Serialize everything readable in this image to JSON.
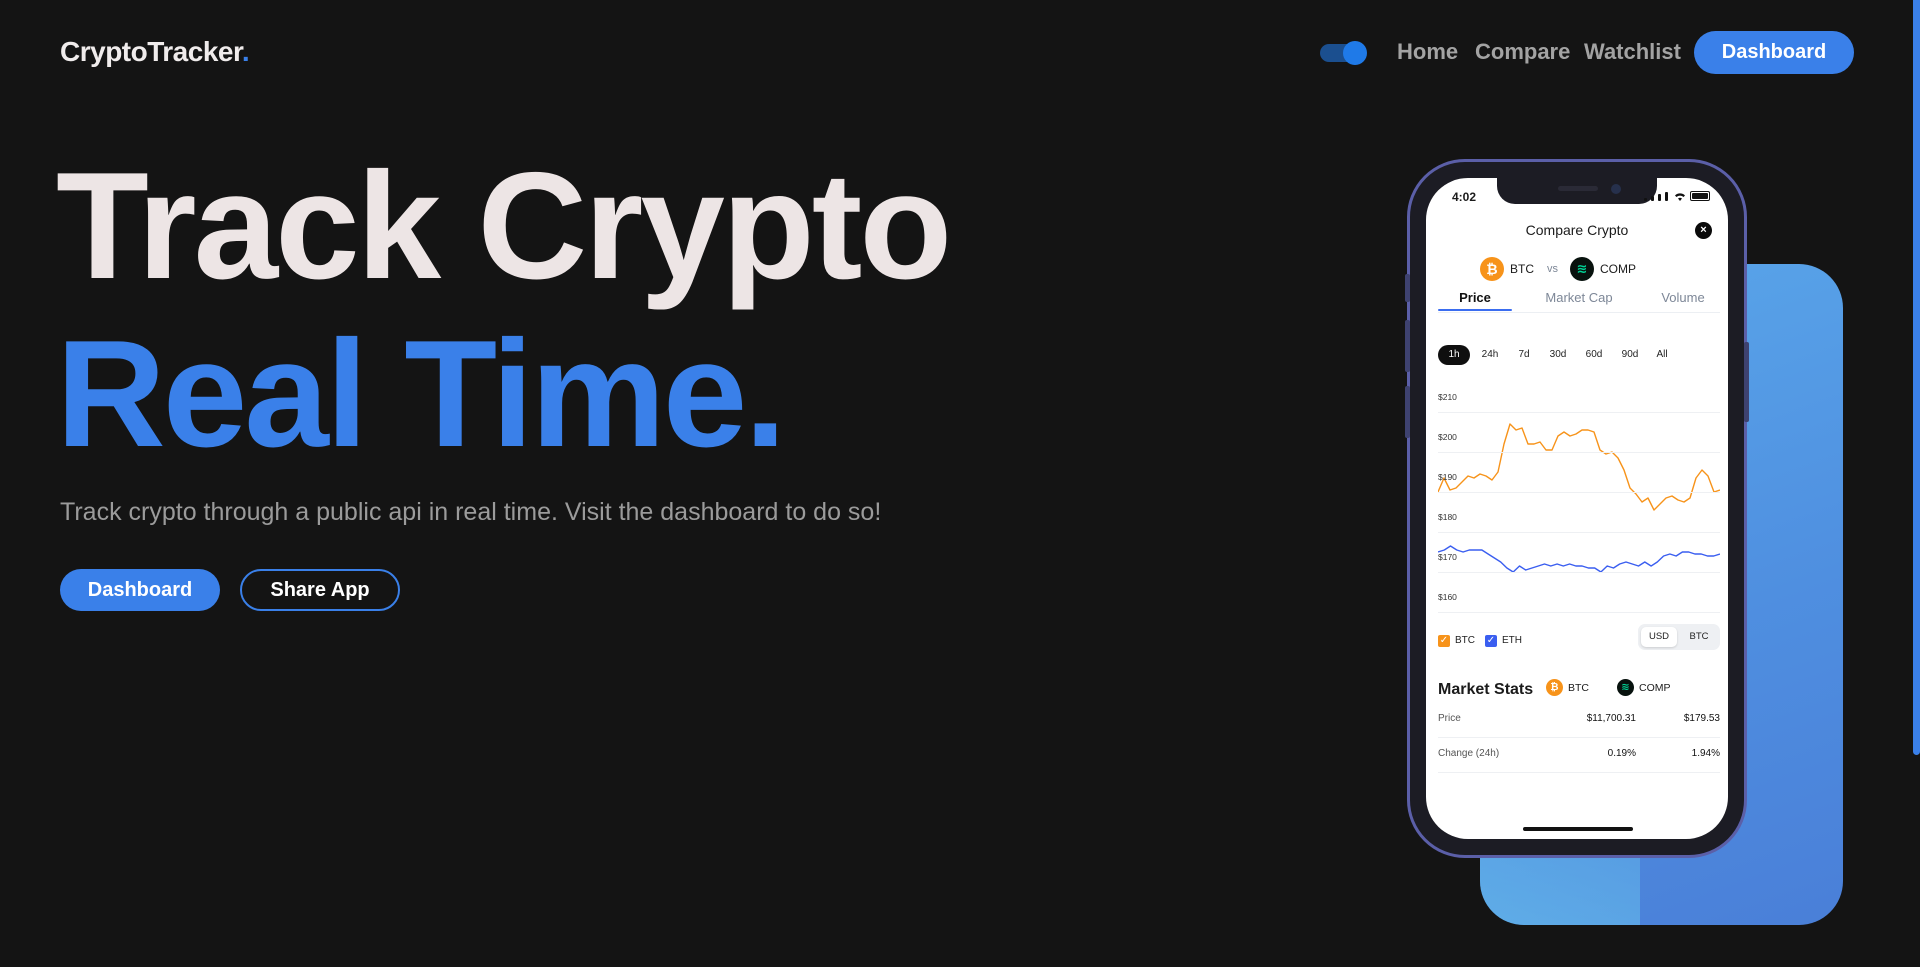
{
  "nav": {
    "logo": "CryptoTracker",
    "logo_dot": ".",
    "links": [
      "Home",
      "Compare",
      "Watchlist"
    ],
    "dashboard_label": "Dashboard"
  },
  "hero": {
    "title_line1": "Track Crypto",
    "title_line2": "Real Time.",
    "subtitle": "Track crypto through a public api in real time. Visit the dashboard to do so!",
    "dashboard_button": "Dashboard",
    "share_button": "Share App"
  },
  "colors": {
    "accent": "#3a80e9",
    "background": "#141414",
    "btc_series": "#f7931a",
    "eth_series": "#3a5ef0"
  },
  "phone": {
    "status_time": "4:02",
    "screen_title": "Compare Crypto",
    "close_icon": "×",
    "coin_a": {
      "symbol": "BTC",
      "icon": "bitcoin-icon"
    },
    "vs": "vs",
    "coin_b": {
      "symbol": "COMP",
      "icon": "compound-icon"
    },
    "tabs": [
      "Price",
      "Market Cap",
      "Volume"
    ],
    "active_tab": "Price",
    "ranges": [
      "1h",
      "24h",
      "7d",
      "30d",
      "60d",
      "90d",
      "All"
    ],
    "active_range": "1h",
    "legend": [
      {
        "label": "BTC",
        "checked": true
      },
      {
        "label": "ETH",
        "checked": true
      }
    ],
    "unit_options": [
      "USD",
      "BTC"
    ],
    "active_unit": "USD",
    "market_stats": {
      "title": "Market Stats",
      "columns": [
        "BTC",
        "COMP"
      ],
      "rows": [
        {
          "label": "Price",
          "a": "$11,700.31",
          "b": "$179.53"
        },
        {
          "label": "Change (24h)",
          "a": "0.19%",
          "b": "1.94%"
        }
      ]
    }
  },
  "chart_data": {
    "type": "line",
    "yticks": [
      "$210",
      "$200",
      "$190",
      "$180",
      "$170",
      "$160"
    ],
    "ylim": [
      160,
      210
    ],
    "series": [
      {
        "name": "BTC",
        "color": "#f7931a",
        "values": [
          186.5,
          190,
          187,
          187.5,
          189,
          190.5,
          190,
          191,
          190.5,
          189.5,
          191.5,
          198.5,
          203.5,
          202,
          202.5,
          198.5,
          198.5,
          199,
          197,
          197,
          200.5,
          201.5,
          200.5,
          201,
          202,
          202,
          201.5,
          197,
          196,
          196.5,
          195,
          192,
          187.5,
          186,
          184,
          185,
          182,
          183.5,
          185,
          185.5,
          184.5,
          184,
          185,
          190,
          192,
          190.5,
          186.5,
          187
        ]
      },
      {
        "name": "ETH",
        "color": "#3a5ef0",
        "values": [
          171.5,
          172,
          173,
          172,
          171.5,
          172,
          172,
          172,
          171,
          170,
          169,
          167.5,
          166.5,
          168,
          167,
          167.5,
          168,
          168.5,
          168,
          168.5,
          168,
          168.5,
          168,
          168,
          167.5,
          167.5,
          166.5,
          168,
          167.5,
          168.5,
          169,
          168.5,
          168,
          169,
          168,
          169,
          170.5,
          171,
          170.5,
          171.5,
          171.5,
          171,
          171,
          170.5,
          170.5,
          171
        ]
      }
    ]
  }
}
